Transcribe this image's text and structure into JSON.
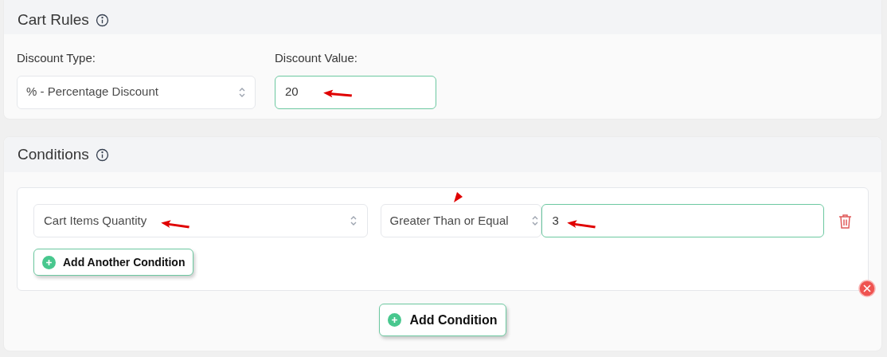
{
  "cart_rules": {
    "title": "Cart Rules",
    "discount_type": {
      "label": "Discount Type:",
      "value": "% - Percentage Discount"
    },
    "discount_value": {
      "label": "Discount Value:",
      "value": "20"
    }
  },
  "conditions": {
    "title": "Conditions",
    "groups": [
      {
        "rows": [
          {
            "field": "Cart Items Quantity",
            "operator": "Greater Than or Equal",
            "value": "3"
          }
        ],
        "add_button": "Add Another Condition"
      }
    ],
    "add_button": "Add Condition"
  }
}
